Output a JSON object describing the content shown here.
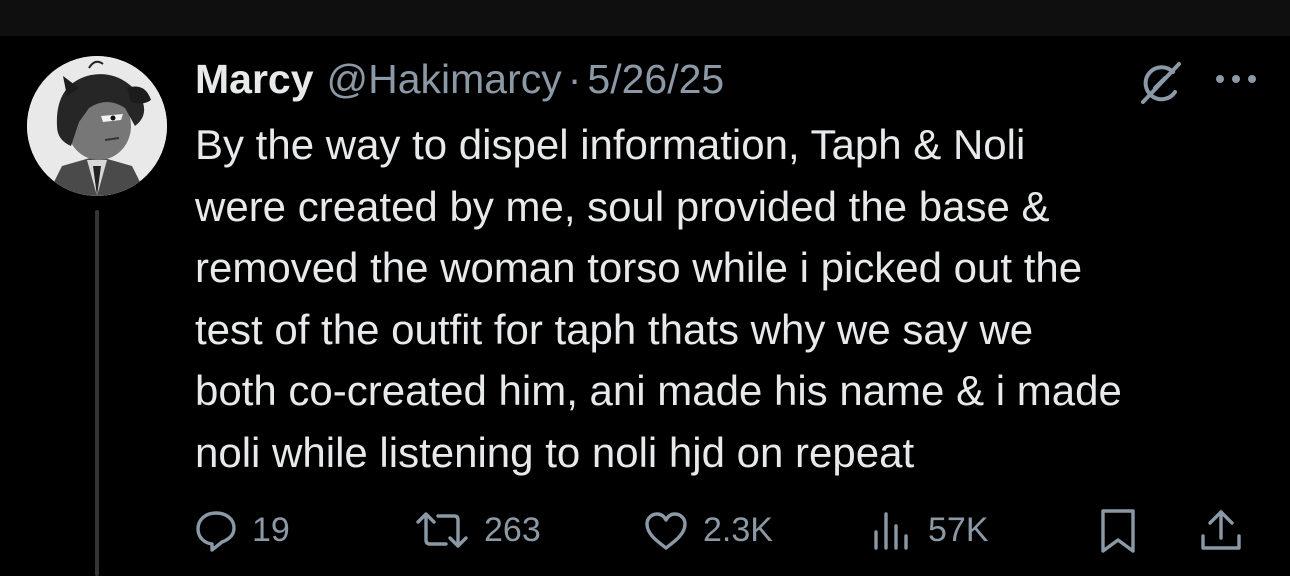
{
  "tweet": {
    "display_name": "Marcy",
    "handle": "@Hakimarcy",
    "separator": "·",
    "date": "5/26/25",
    "text_lines": [
      "By the way to dispel information, Taph & Noli",
      "were created by me, soul provided the base &",
      "removed the woman torso while i picked out the",
      "test of the outfit for taph thats why we say we",
      "both co-created him, ani made his name & i made",
      "noli while listening to noli hjd on repeat"
    ]
  },
  "actions": {
    "replies": "19",
    "reposts": "263",
    "likes": "2.3K",
    "views": "57K"
  },
  "icons": {
    "grok": "grok-icon",
    "more": "more-icon",
    "reply": "reply-icon",
    "repost": "repost-icon",
    "like": "heart-icon",
    "views": "views-icon",
    "bookmark": "bookmark-icon",
    "share": "share-icon"
  },
  "colors": {
    "background": "#000000",
    "primary_text": "#e7e9ea",
    "secondary_text": "#8b98a5",
    "thread_line": "#333639"
  }
}
